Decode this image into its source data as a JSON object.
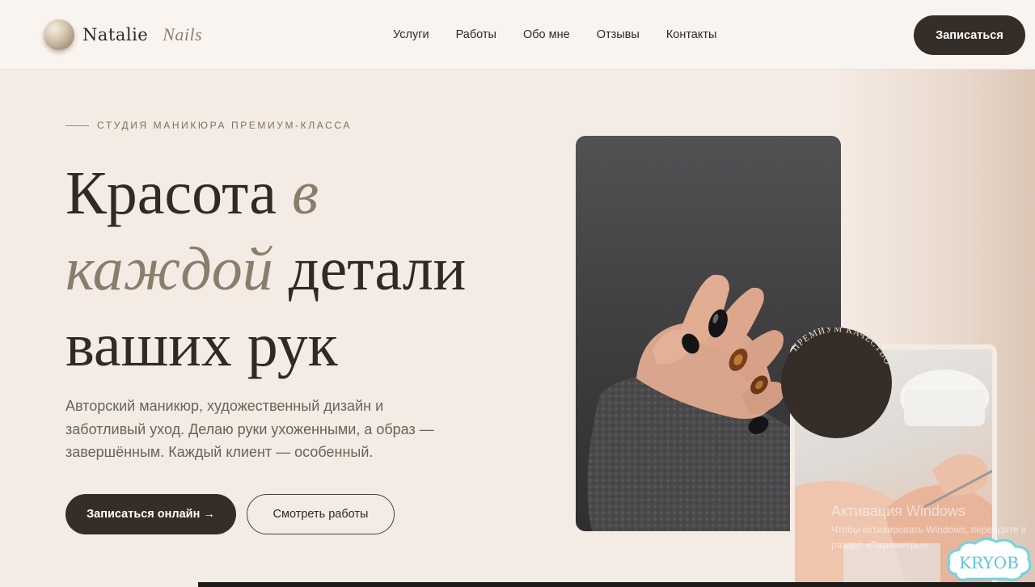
{
  "header": {
    "logo_name": "Natalie",
    "logo_sub": "Nails",
    "nav": [
      "Услуги",
      "Работы",
      "Обо мне",
      "Отзывы",
      "Контакты"
    ],
    "cta_label": "Записаться"
  },
  "hero": {
    "eyebrow": "СТУДИЯ МАНИКЮРА ПРЕМИУМ-КЛАССА",
    "title": {
      "part1": "Красота ",
      "part1_accent": "в",
      "part2_accent": "каждой",
      "part2": " детали",
      "part3": "ваших рук"
    },
    "description": "Авторский маникюр, художественный дизайн и заботливый уход. Делаю руки ухоженными, а образ — завершённым. Каждый клиент — особенный.",
    "primary_button": "Записаться онлайн →",
    "secondary_button": "Смотреть работы"
  },
  "badge": {
    "text": "ПРЕМИУМ КАЧЕСТВО"
  },
  "watermark": {
    "title": "Активация Windows",
    "subtitle": "Чтобы активировать Windows, перейдите в раздел «Параметры»."
  },
  "stamp": {
    "text": "KRYOB"
  },
  "colors": {
    "background": "#f4ebe4",
    "header_bg": "#faf4f0",
    "dark": "#352d27",
    "accent": "#8a7d6a"
  }
}
